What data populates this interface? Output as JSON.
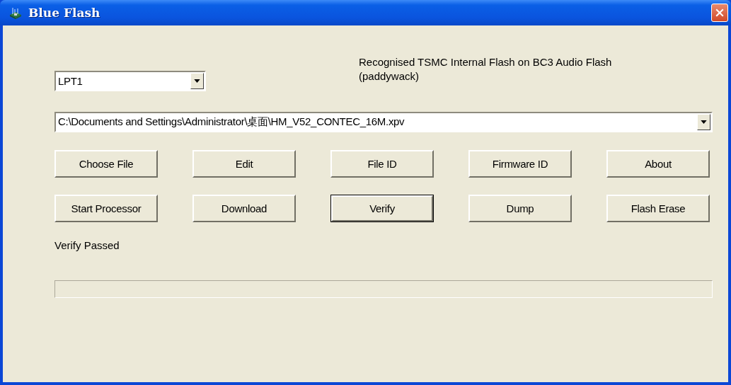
{
  "window": {
    "title": "Blue Flash"
  },
  "port": {
    "value": "LPT1"
  },
  "device_info": "Recognised TSMC Internal Flash on BC3 Audio Flash (paddywack)",
  "file_path": {
    "value": "C:\\Documents and Settings\\Administrator\\桌面\\HM_V52_CONTEC_16M.xpv"
  },
  "buttons": [
    {
      "label": "Choose File",
      "default": false
    },
    {
      "label": "Edit",
      "default": false
    },
    {
      "label": "File ID",
      "default": false
    },
    {
      "label": "Firmware ID",
      "default": false
    },
    {
      "label": "About",
      "default": false
    },
    {
      "label": "Start Processor",
      "default": false
    },
    {
      "label": "Download",
      "default": false
    },
    {
      "label": "Verify",
      "default": true
    },
    {
      "label": "Dump",
      "default": false
    },
    {
      "label": "Flash Erase",
      "default": false
    }
  ],
  "status": "Verify Passed"
}
